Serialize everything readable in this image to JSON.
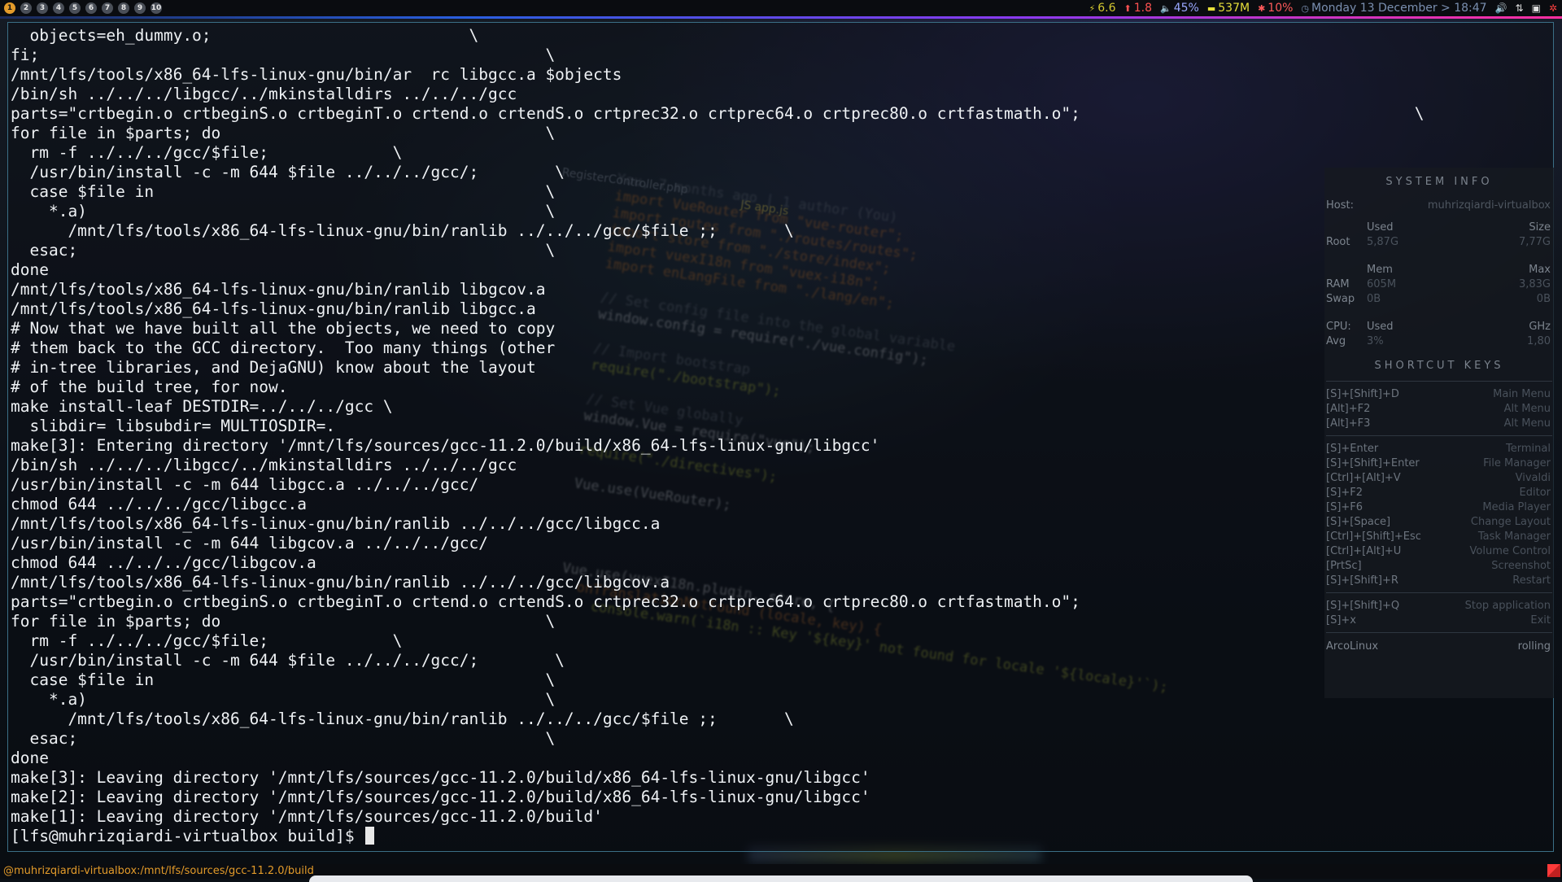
{
  "workspaces": [
    {
      "label": "1",
      "active": true
    },
    {
      "label": "2",
      "active": false
    },
    {
      "label": "3",
      "active": false
    },
    {
      "label": "4",
      "active": false
    },
    {
      "label": "5",
      "active": false
    },
    {
      "label": "6",
      "active": false
    },
    {
      "label": "7",
      "active": false
    },
    {
      "label": "8",
      "active": false
    },
    {
      "label": "9",
      "active": false
    },
    {
      "label": "10",
      "active": false
    }
  ],
  "status": {
    "load": "6.6",
    "upload": "1.8",
    "volume": "45%",
    "memory": "537M",
    "cpu": "10%",
    "datetime": "Monday 13 December > 18:47"
  },
  "terminal": {
    "lines": [
      "  objects=eh_dummy.o;                           \\",
      "fi;                                                     \\",
      "/mnt/lfs/tools/x86_64-lfs-linux-gnu/bin/ar  rc libgcc.a $objects",
      "/bin/sh ../../../libgcc/../mkinstalldirs ../../../gcc",
      "parts=\"crtbegin.o crtbeginS.o crtbeginT.o crtend.o crtendS.o crtprec32.o crtprec64.o crtprec80.o crtfastmath.o\";                                   \\",
      "for file in $parts; do                                  \\",
      "  rm -f ../../../gcc/$file;             \\",
      "  /usr/bin/install -c -m 644 $file ../../../gcc/;        \\",
      "  case $file in                                         \\",
      "    *.a)                                                \\",
      "      /mnt/lfs/tools/x86_64-lfs-linux-gnu/bin/ranlib ../../../gcc/$file ;;       \\",
      "  esac;                                                 \\",
      "done",
      "/mnt/lfs/tools/x86_64-lfs-linux-gnu/bin/ranlib libgcov.a",
      "/mnt/lfs/tools/x86_64-lfs-linux-gnu/bin/ranlib libgcc.a",
      "# Now that we have built all the objects, we need to copy",
      "# them back to the GCC directory.  Too many things (other",
      "# in-tree libraries, and DejaGNU) know about the layout",
      "# of the build tree, for now.",
      "make install-leaf DESTDIR=../../../gcc \\",
      "  slibdir= libsubdir= MULTIOSDIR=.",
      "make[3]: Entering directory '/mnt/lfs/sources/gcc-11.2.0/build/x86_64-lfs-linux-gnu/libgcc'",
      "/bin/sh ../../../libgcc/../mkinstalldirs ../../../gcc",
      "/usr/bin/install -c -m 644 libgcc.a ../../../gcc/",
      "chmod 644 ../../../gcc/libgcc.a",
      "/mnt/lfs/tools/x86_64-lfs-linux-gnu/bin/ranlib ../../../gcc/libgcc.a",
      "/usr/bin/install -c -m 644 libgcov.a ../../../gcc/",
      "chmod 644 ../../../gcc/libgcov.a",
      "/mnt/lfs/tools/x86_64-lfs-linux-gnu/bin/ranlib ../../../gcc/libgcov.a",
      "parts=\"crtbegin.o crtbeginS.o crtbeginT.o crtend.o crtendS.o crtprec32.o crtprec64.o crtprec80.o crtfastmath.o\";",
      "for file in $parts; do                                  \\",
      "  rm -f ../../../gcc/$file;             \\",
      "  /usr/bin/install -c -m 644 $file ../../../gcc/;        \\",
      "  case $file in                                         \\",
      "    *.a)                                                \\",
      "      /mnt/lfs/tools/x86_64-lfs-linux-gnu/bin/ranlib ../../../gcc/$file ;;       \\",
      "  esac;                                                 \\",
      "done",
      "make[3]: Leaving directory '/mnt/lfs/sources/gcc-11.2.0/build/x86_64-lfs-linux-gnu/libgcc'",
      "make[2]: Leaving directory '/mnt/lfs/sources/gcc-11.2.0/build/x86_64-lfs-linux-gnu/libgcc'",
      "make[1]: Leaving directory '/mnt/lfs/sources/gcc-11.2.0/build'"
    ],
    "prompt": "[lfs@muhrizqiardi-virtualbox build]$ "
  },
  "conky": {
    "system_title": "SYSTEM INFO",
    "host_label": "Host:",
    "host_value": "muhrizqiardi-virtualbox",
    "disk_header_used": "Used",
    "disk_header_size": "Size",
    "root_label": "Root",
    "root_used": "5,87G",
    "root_size": "7,77G",
    "mem_header_mem": "Mem",
    "mem_header_max": "Max",
    "ram_label": "RAM",
    "ram_used": "605M",
    "ram_max": "3,83G",
    "swap_label": "Swap",
    "swap_used": "0B",
    "swap_max": "0B",
    "cpu_label": "CPU:",
    "cpu_used_label": "Used",
    "cpu_ghz_label": "GHz",
    "avg_label": "Avg",
    "avg_used": "3%",
    "avg_ghz": "1,80",
    "shortcut_title": "SHORTCUT KEYS",
    "shortcuts_group1": [
      {
        "key": "[S]+[Shift]+D",
        "action": "Main Menu"
      },
      {
        "key": "[Alt]+F2",
        "action": "Alt Menu"
      },
      {
        "key": "[Alt]+F3",
        "action": "Alt Menu"
      }
    ],
    "shortcuts_group2": [
      {
        "key": "[S]+Enter",
        "action": "Terminal"
      },
      {
        "key": "[S]+[Shift]+Enter",
        "action": "File Manager"
      },
      {
        "key": "[Ctrl]+[Alt]+V",
        "action": "Vivaldi"
      },
      {
        "key": "[S]+F2",
        "action": "Editor"
      },
      {
        "key": "[S]+F6",
        "action": "Media Player"
      },
      {
        "key": "[S]+[Space]",
        "action": "Change Layout"
      },
      {
        "key": "[Ctrl]+[Shift]+Esc",
        "action": "Task Manager"
      },
      {
        "key": "[Ctrl]+[Alt]+U",
        "action": "Volume Control"
      },
      {
        "key": "[PrtSc]",
        "action": "Screenshot"
      },
      {
        "key": "[S]+[Shift]+R",
        "action": "Restart"
      }
    ],
    "shortcuts_group3": [
      {
        "key": "[S]+[Shift]+Q",
        "action": "Stop application"
      },
      {
        "key": "[S]+x",
        "action": "Exit"
      }
    ],
    "distro": "ArcoLinux",
    "release": "rolling"
  },
  "wallpaper": {
    "tab1": "RegisterController.php",
    "tab2": "JS app.js",
    "code": [
      {
        "text": "You, 7 months ago | 1 author (You)",
        "cls": "k-gray"
      },
      {
        "text": "import VueRouter from \"vue-router\";",
        "cls": "k-orange"
      },
      {
        "text": "import routes from \"./routes/routes\";",
        "cls": "k-orange"
      },
      {
        "text": "import store from \"./store/index\";",
        "cls": "k-orange"
      },
      {
        "text": "import vuexI18n from \"vuex-i18n\";",
        "cls": "k-orange"
      },
      {
        "text": "import enLangFile from \"./lang/en\";",
        "cls": "k-orange"
      },
      {
        "text": "",
        "cls": "k-gray"
      },
      {
        "text": "// Set config file into the global variable",
        "cls": "k-gray"
      },
      {
        "text": "window.config = require(\"./vue.config\");",
        "cls": "k-white"
      },
      {
        "text": "",
        "cls": "k-gray"
      },
      {
        "text": "// Import bootstrap",
        "cls": "k-gray"
      },
      {
        "text": "require(\"./bootstrap\");",
        "cls": "k-green"
      },
      {
        "text": "",
        "cls": "k-gray"
      },
      {
        "text": "// Set Vue globally",
        "cls": "k-gray"
      },
      {
        "text": "window.Vue = require(\"vue\");",
        "cls": "k-white"
      },
      {
        "text": "",
        "cls": "k-gray"
      },
      {
        "text": "require(\"./directives\");",
        "cls": "k-green"
      },
      {
        "text": "",
        "cls": "k-gray"
      },
      {
        "text": "Vue.use(VueRouter);",
        "cls": "k-white"
      },
      {
        "text": "",
        "cls": "k-gray"
      },
      {
        "text": "",
        "cls": "k-gray"
      },
      {
        "text": "",
        "cls": "k-gray"
      },
      {
        "text": "",
        "cls": "k-gray"
      },
      {
        "text": "Vue.use(vuexI18n.plugin, store, {",
        "cls": "k-white"
      },
      {
        "text": "  onTranslationNotFound (locale, key) {",
        "cls": "k-orange"
      },
      {
        "text": "    console.warn(`i18n :: Key '${key}' not found for locale '${locale}'`);",
        "cls": "k-green"
      }
    ]
  },
  "bottom": {
    "path": "@muhrizqiardi-virtualbox:/mnt/lfs/sources/gcc-11.2.0/build"
  }
}
